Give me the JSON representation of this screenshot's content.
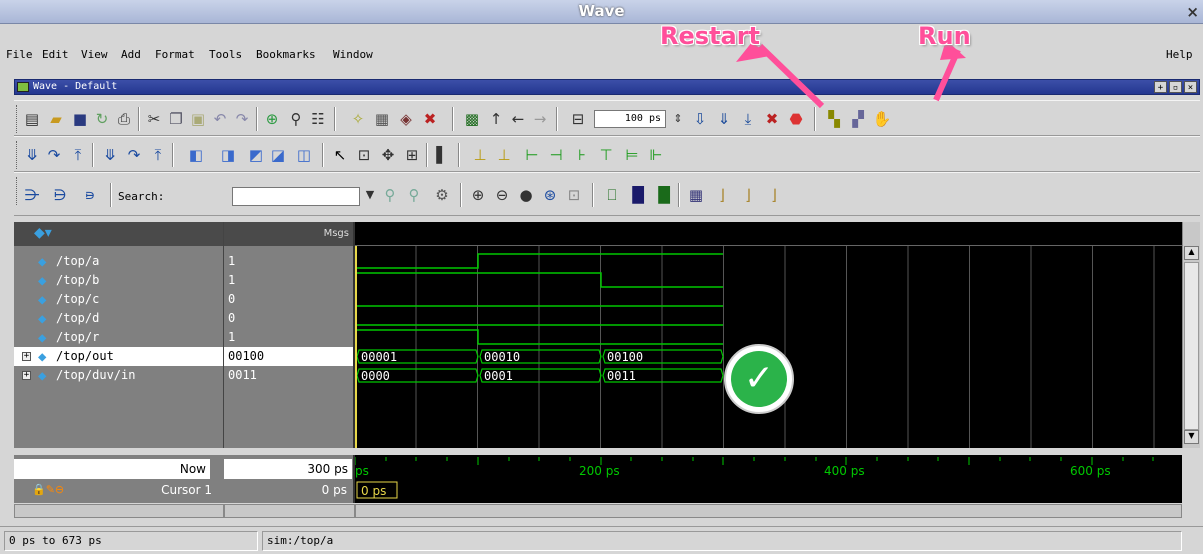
{
  "window": {
    "title": "Wave",
    "close_glyph": "×"
  },
  "menu": {
    "items": [
      "File",
      "Edit",
      "View",
      "Add",
      "Format",
      "Tools",
      "Bookmarks",
      "Window"
    ],
    "help": "Help"
  },
  "subwindow": {
    "title": "Wave - Default"
  },
  "toolbar": {
    "run_length": "100 ps",
    "search_label": "Search:",
    "search_value": ""
  },
  "panes": {
    "msgs_header": "Msgs"
  },
  "signals": [
    {
      "name": "/top/a",
      "value": "1",
      "expandable": false
    },
    {
      "name": "/top/b",
      "value": "1",
      "expandable": false
    },
    {
      "name": "/top/c",
      "value": "0",
      "expandable": false
    },
    {
      "name": "/top/d",
      "value": "0",
      "expandable": false
    },
    {
      "name": "/top/r",
      "value": "1",
      "expandable": false
    },
    {
      "name": "/top/out",
      "value": "00100",
      "expandable": true,
      "selected": true
    },
    {
      "name": "/top/duv/in",
      "value": "0011",
      "expandable": true
    }
  ],
  "bus_values": {
    "out": [
      "00001",
      "00010",
      "00100"
    ],
    "in": [
      "0000",
      "0001",
      "0011"
    ]
  },
  "timeline": {
    "now_label": "Now",
    "now_value": "300 ps",
    "cursor_label": "Cursor 1",
    "cursor_value": "0 ps",
    "cursor_marker": "0 ps",
    "ticks": [
      "ps",
      "200 ps",
      "400 ps",
      "600 ps"
    ]
  },
  "status": {
    "range": "0 ps to 673 ps",
    "path": "sim:/top/a"
  },
  "annotations": {
    "restart": "Restart",
    "run": "Run"
  },
  "colors": {
    "wave": "#00c800",
    "cursor": "#e8d84a",
    "annotation": "#ff4f9a",
    "check": "#2bb34a"
  }
}
